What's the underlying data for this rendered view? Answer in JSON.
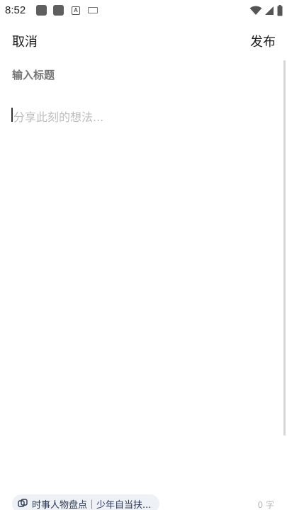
{
  "status_bar": {
    "time": "8:52",
    "icons": [
      "notification-box-icon",
      "notification-box-icon",
      "font-a-icon",
      "keyboard-icon",
      "wifi-icon",
      "signal-icon",
      "battery-icon"
    ]
  },
  "header": {
    "cancel_label": "取消",
    "publish_label": "发布"
  },
  "editor": {
    "title_placeholder": "输入标题",
    "content_placeholder": "分享此刻的想法..."
  },
  "footer": {
    "topic_chip": "时事人物盘点｜少年自当扶...",
    "word_count": "0 字"
  },
  "colors": {
    "chip_background": "#eef1f6",
    "chip_text": "#2c3650",
    "placeholder": "#bdbdbd"
  }
}
